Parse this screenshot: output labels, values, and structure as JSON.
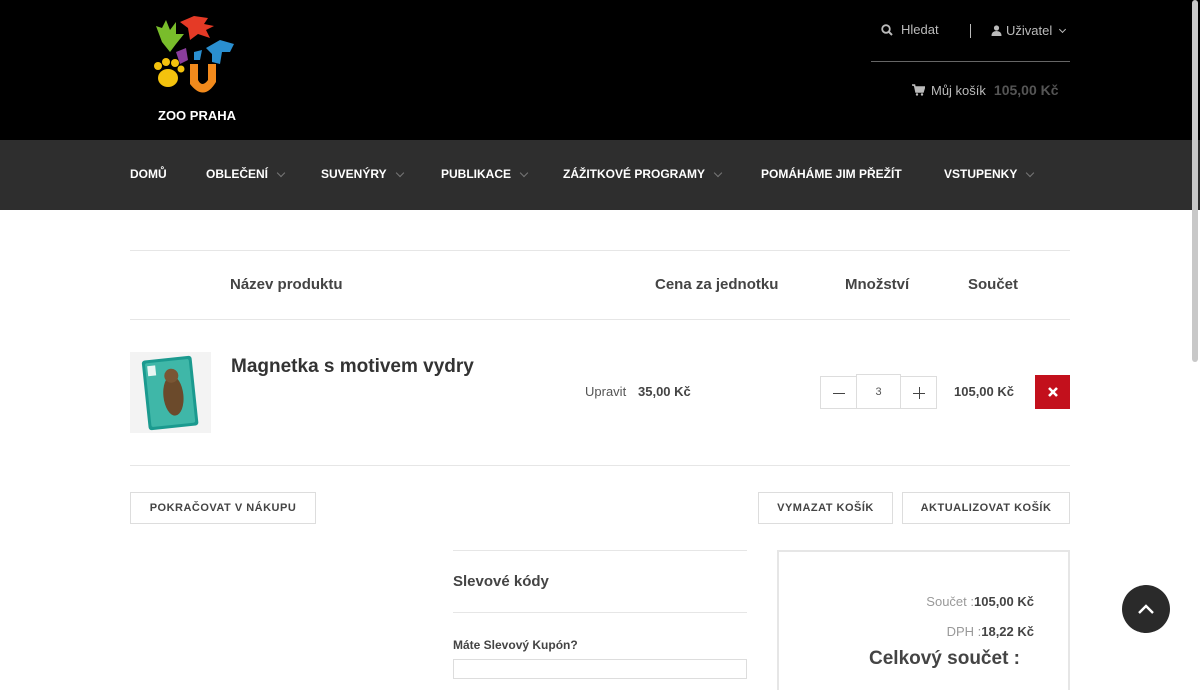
{
  "brand": {
    "logo_text": "ZOO PRAHA"
  },
  "header": {
    "search_label": "Hledat",
    "user_label": "Uživatel",
    "cart_label": "Můj košík",
    "cart_total": "105,00 Kč"
  },
  "nav": {
    "items": [
      {
        "label": "DOMŮ"
      },
      {
        "label": "OBLEČENÍ"
      },
      {
        "label": "SUVENÝRY"
      },
      {
        "label": "PUBLIKACE"
      },
      {
        "label": "ZÁŽITKOVÉ PROGRAMY"
      },
      {
        "label": "POMÁHÁME JIM PŘEŽÍT"
      },
      {
        "label": "VSTUPENKY"
      }
    ]
  },
  "cart_table": {
    "headers": {
      "product": "Název produktu",
      "unit_price": "Cena za jednotku",
      "quantity": "Množství",
      "subtotal": "Součet"
    },
    "rows": [
      {
        "name": "Magnetka s motivem vydry",
        "edit_label": "Upravit",
        "unit_price": "35,00 Kč",
        "quantity": "3",
        "total": "105,00 Kč"
      }
    ]
  },
  "actions": {
    "continue": "POKRAČOVAT V NÁKUPU",
    "clear": "VYMAZAT KOŠÍK",
    "update": "AKTUALIZOVAT KOŠÍK"
  },
  "coupon": {
    "title": "Slevové kódy",
    "question": "Máte Slevový Kupón?"
  },
  "totals": {
    "subtotal_label": "Součet :",
    "subtotal_value": "105,00 Kč",
    "vat_label": "DPH :",
    "vat_value": "18,22 Kč",
    "grand_label": "Celkový součet :"
  },
  "colors": {
    "header_bg": "#000000",
    "nav_bg": "#2e2e2e",
    "delete_red": "#c3101c",
    "totop_bg": "#2a2a2a"
  },
  "icons": [
    "search-icon",
    "user-icon",
    "cart-icon",
    "chevron-down-icon",
    "minus-icon",
    "plus-icon",
    "close-icon",
    "chevron-up-icon"
  ]
}
